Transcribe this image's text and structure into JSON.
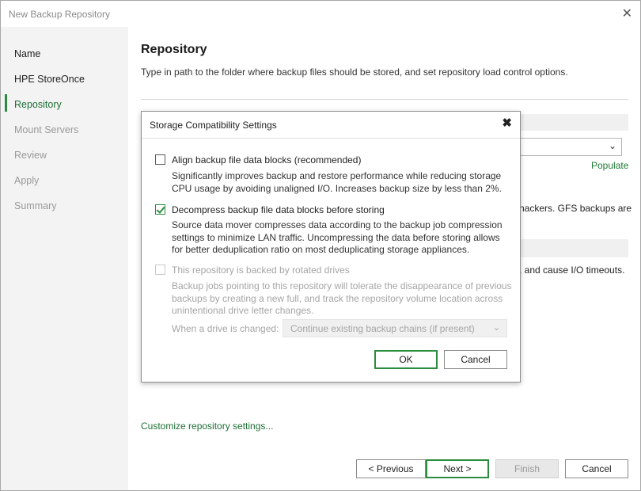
{
  "window": {
    "title": "New Backup Repository",
    "close_glyph": "✕"
  },
  "sidebar": {
    "items": [
      {
        "label": "Name",
        "state": "normal"
      },
      {
        "label": "HPE StoreOnce",
        "state": "normal"
      },
      {
        "label": "Repository",
        "state": "active"
      },
      {
        "label": "Mount Servers",
        "state": "disabled"
      },
      {
        "label": "Review",
        "state": "disabled"
      },
      {
        "label": "Apply",
        "state": "disabled"
      },
      {
        "label": "Summary",
        "state": "disabled"
      }
    ]
  },
  "main": {
    "title": "Repository",
    "description": "Type in path to the folder where backup files should be stored, and set repository load control options.",
    "populate_label": "Populate",
    "bg_text_1": "hackers. GFS backups are",
    "bg_text_2": ", and cause I/O timeouts.",
    "customize_link": "Customize repository settings..."
  },
  "footer": {
    "previous": "< Previous",
    "next": "Next >",
    "finish": "Finish",
    "cancel": "Cancel"
  },
  "modal": {
    "title": "Storage Compatibility Settings",
    "close_glyph": "✖",
    "options": [
      {
        "label": "Align backup file data blocks (recommended)",
        "checked": false,
        "enabled": true,
        "description": "Significantly improves backup and restore performance while reducing storage CPU usage by avoiding unaligned I/O. Increases backup size by less than 2%."
      },
      {
        "label": "Decompress backup file data blocks before storing",
        "checked": true,
        "enabled": true,
        "description": "Source data mover compresses data according to the backup job compression settings to minimize LAN traffic. Uncompressing the data before storing allows for better deduplication ratio on most deduplicating storage appliances."
      },
      {
        "label": "This repository is backed by rotated drives",
        "checked": false,
        "enabled": false,
        "description": "Backup jobs pointing to this repository will tolerate the disappearance of previous backups by creating a new full, and track the repository volume location across unintentional drive letter changes."
      }
    ],
    "drive_change_label": "When a drive is changed:",
    "drive_change_value": "Continue existing backup chains (if present)",
    "ok": "OK",
    "cancel": "Cancel"
  },
  "colors": {
    "accent": "#2a8c3e",
    "link": "#1e6e35",
    "sidebar_bg": "#f3f3f3",
    "disabled_text": "#a5a5a5"
  }
}
